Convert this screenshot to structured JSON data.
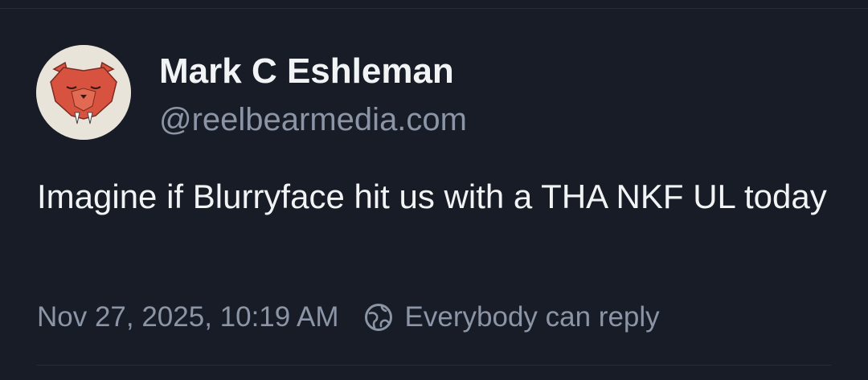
{
  "post": {
    "author": {
      "display_name": "Mark C Eshleman",
      "handle": "@reelbearmedia.com",
      "avatar_icon": "red-bear-drawing-avatar"
    },
    "text": "Imagine if Blurryface hit us with a THA NKF UL today",
    "timestamp": "Nov 27, 2025, 10:19 AM",
    "reply_setting": {
      "icon": "globe-icon",
      "label": "Everybody can reply"
    }
  },
  "colors": {
    "background": "#171c26",
    "primary_text": "#f1f3f5",
    "secondary_text": "#8b95a6",
    "avatar_bear": "#d8533f"
  }
}
